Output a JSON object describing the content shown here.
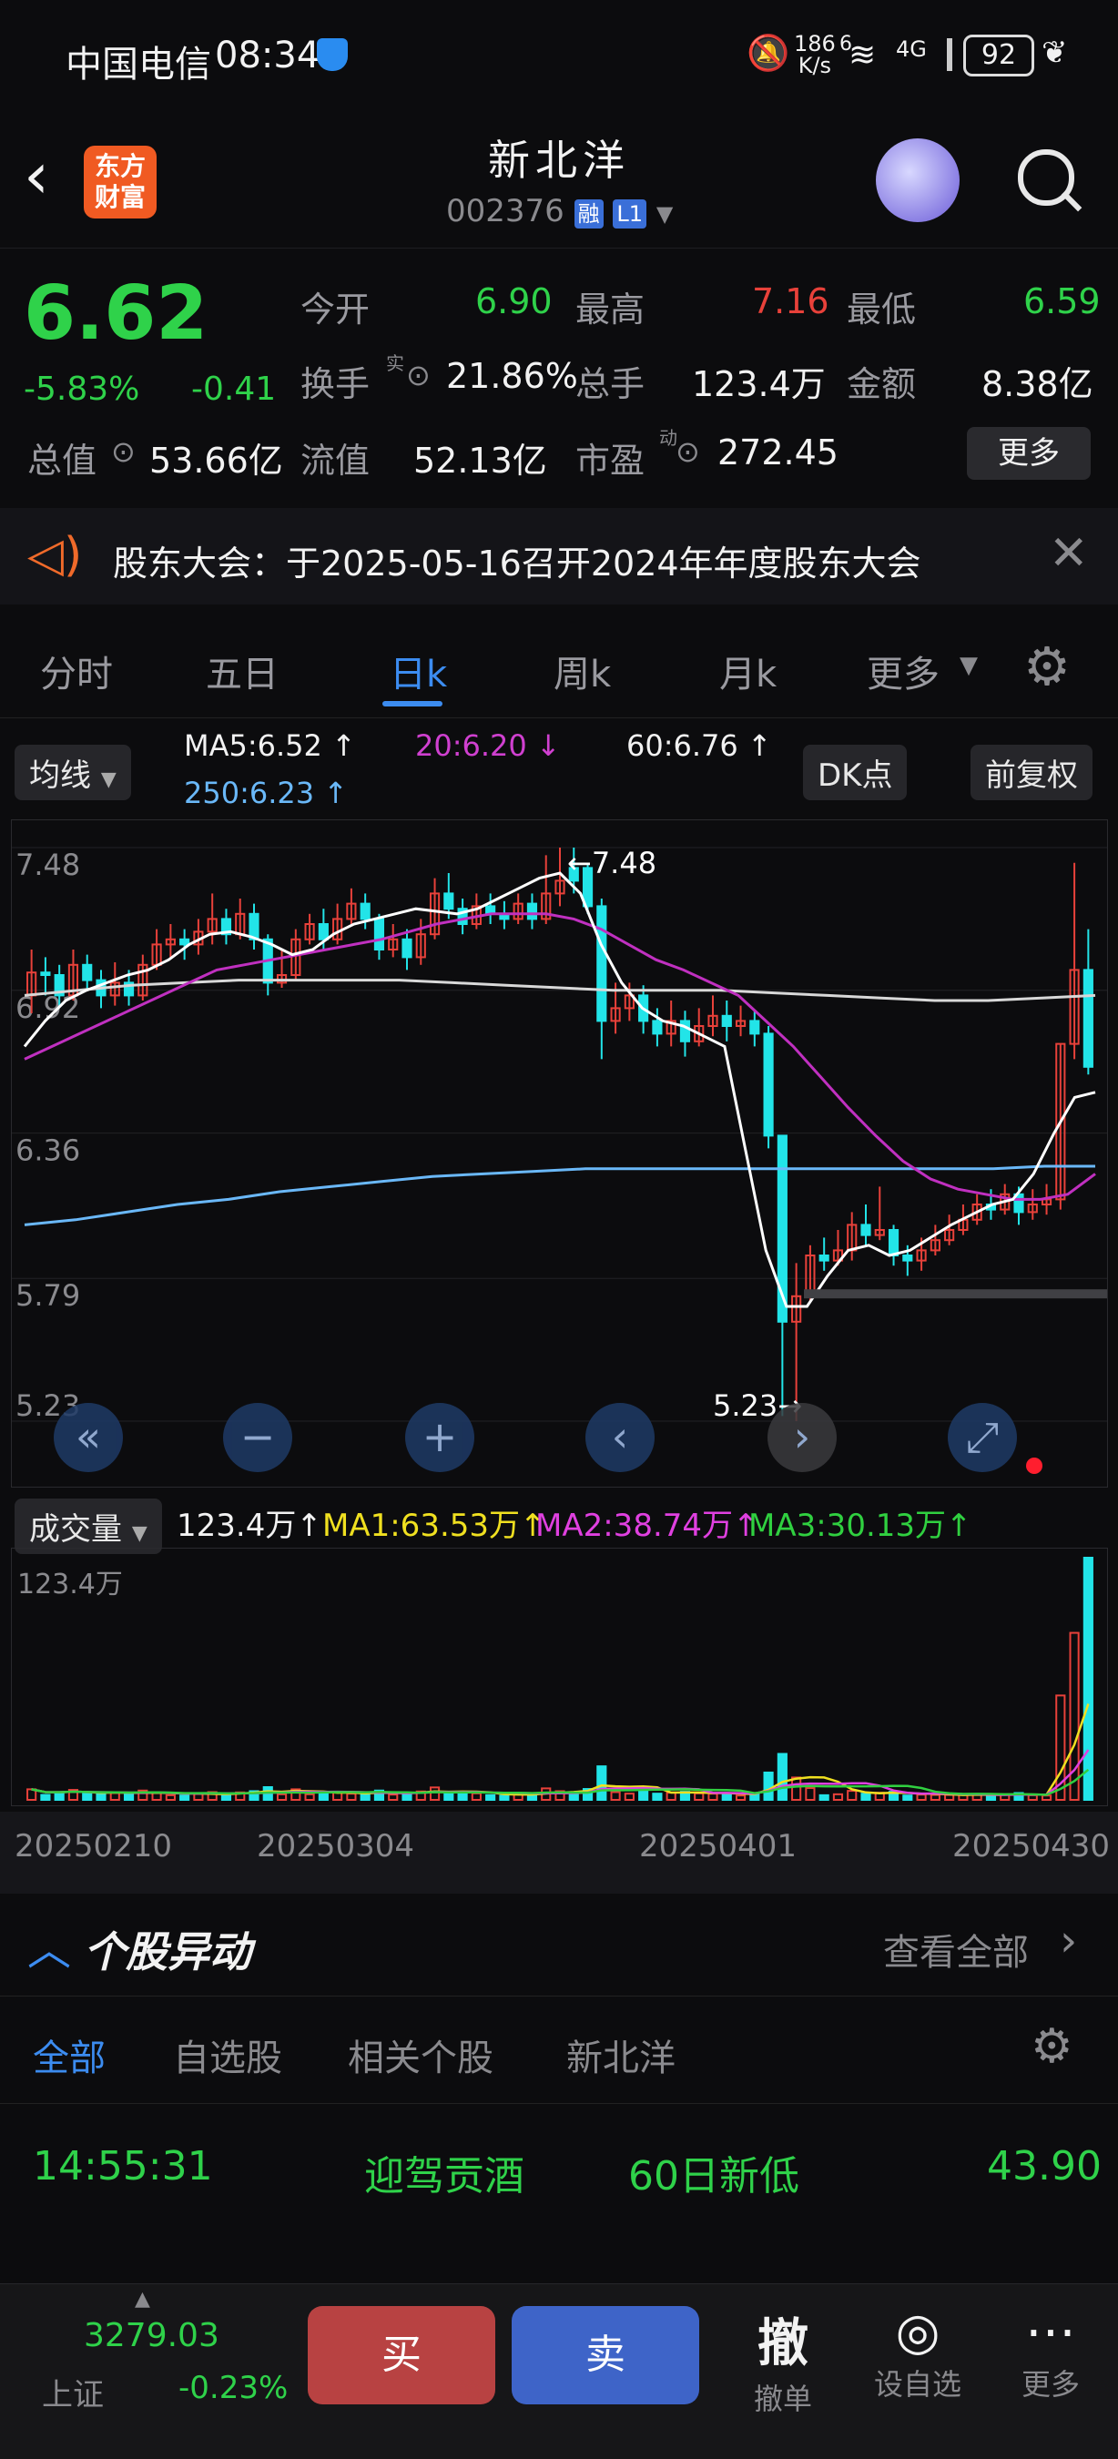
{
  "status_bar": {
    "carrier": "中国电信",
    "time": "08:34",
    "speed_top": "186",
    "speed_unit": "K/s",
    "net_sup": "6",
    "net_type": "4G",
    "battery": "92"
  },
  "header": {
    "logo_line1": "东方",
    "logo_line2": "财富",
    "stock_name": "新北洋",
    "stock_code": "002376",
    "badge_rong": "融",
    "badge_level": "L1"
  },
  "quote": {
    "price": "6.62",
    "change_pct": "-5.83%",
    "change": "-0.41",
    "open_label": "今开",
    "open": "6.90",
    "high_label": "最高",
    "high": "7.16",
    "low_label": "最低",
    "low": "6.59",
    "turnover_label": "换手",
    "turnover_sup": "实",
    "turnover": "21.86%",
    "volume_label": "总手",
    "volume": "123.4万",
    "amount_label": "金额",
    "amount": "8.38亿",
    "mcap_label": "总值",
    "mcap": "53.66亿",
    "float_label": "流值",
    "float": "52.13亿",
    "pe_label": "市盈",
    "pe_sup": "动",
    "pe": "272.45",
    "more": "更多"
  },
  "notice": {
    "text": "股东大会：于2025-05-16召开2024年年度股东大会"
  },
  "tabs": [
    {
      "label": "分时"
    },
    {
      "label": "五日"
    },
    {
      "label": "日k"
    },
    {
      "label": "周k"
    },
    {
      "label": "月k"
    },
    {
      "label": "更多"
    }
  ],
  "ma_bar": {
    "indicator": "均线",
    "ma5": "MA5:6.52 ↑",
    "ma20": "20:6.20 ↓",
    "ma60": "60:6.76 ↑",
    "ma250": "250:6.23 ↑",
    "dk": "DK点",
    "fq": "前复权"
  },
  "vol_bar": {
    "indicator": "成交量",
    "vol": "123.4万↑",
    "ma1": "MA1:63.53万↑",
    "ma2": "MA2:38.74万↑",
    "ma3": "MA3:30.13万↑",
    "vol_max": "123.4万"
  },
  "chart_data": {
    "type": "candlestick",
    "y_ticks": [
      "7.48",
      "6.92",
      "6.36",
      "5.79",
      "5.23"
    ],
    "ylim": [
      5.23,
      7.48
    ],
    "x_labels": [
      "20250210",
      "20250304",
      "20250401",
      "20250430"
    ],
    "high_annot": "←7.48",
    "low_annot": "5.23→",
    "candles": [
      [
        6.9,
        6.99,
        7.08,
        6.83,
        "up"
      ],
      [
        6.99,
        6.98,
        7.05,
        6.9,
        "down"
      ],
      [
        6.98,
        6.9,
        7.02,
        6.86,
        "down"
      ],
      [
        6.9,
        7.02,
        7.08,
        6.88,
        "up"
      ],
      [
        7.02,
        6.96,
        7.06,
        6.92,
        "down"
      ],
      [
        6.96,
        6.9,
        7.0,
        6.85,
        "down"
      ],
      [
        6.9,
        6.95,
        7.03,
        6.86,
        "up"
      ],
      [
        6.95,
        6.9,
        7.0,
        6.86,
        "down"
      ],
      [
        6.9,
        7.02,
        7.06,
        6.88,
        "up"
      ],
      [
        7.02,
        7.1,
        7.16,
        7.0,
        "up"
      ],
      [
        7.1,
        7.12,
        7.18,
        7.05,
        "up"
      ],
      [
        7.12,
        7.1,
        7.16,
        7.04,
        "down"
      ],
      [
        7.1,
        7.15,
        7.2,
        7.06,
        "up"
      ],
      [
        7.15,
        7.2,
        7.3,
        7.1,
        "up"
      ],
      [
        7.2,
        7.14,
        7.24,
        7.1,
        "down"
      ],
      [
        7.14,
        7.22,
        7.28,
        7.12,
        "up"
      ],
      [
        7.22,
        7.12,
        7.26,
        7.08,
        "down"
      ],
      [
        7.12,
        6.95,
        7.14,
        6.9,
        "down"
      ],
      [
        6.95,
        6.98,
        7.08,
        6.93,
        "up"
      ],
      [
        6.98,
        7.12,
        7.16,
        6.96,
        "up"
      ],
      [
        7.12,
        7.18,
        7.22,
        7.1,
        "up"
      ],
      [
        7.18,
        7.12,
        7.24,
        7.08,
        "down"
      ],
      [
        7.12,
        7.2,
        7.26,
        7.1,
        "up"
      ],
      [
        7.2,
        7.26,
        7.32,
        7.18,
        "up"
      ],
      [
        7.26,
        7.2,
        7.3,
        7.16,
        "down"
      ],
      [
        7.2,
        7.08,
        7.22,
        7.04,
        "down"
      ],
      [
        7.08,
        7.12,
        7.18,
        7.05,
        "up"
      ],
      [
        7.12,
        7.05,
        7.16,
        7.0,
        "down"
      ],
      [
        7.05,
        7.14,
        7.2,
        7.02,
        "up"
      ],
      [
        7.14,
        7.3,
        7.36,
        7.12,
        "up"
      ],
      [
        7.3,
        7.24,
        7.38,
        7.2,
        "down"
      ],
      [
        7.24,
        7.18,
        7.28,
        7.14,
        "down"
      ],
      [
        7.18,
        7.25,
        7.3,
        7.16,
        "up"
      ],
      [
        7.25,
        7.22,
        7.3,
        7.18,
        "down"
      ],
      [
        7.22,
        7.2,
        7.27,
        7.16,
        "down"
      ],
      [
        7.2,
        7.26,
        7.3,
        7.18,
        "up"
      ],
      [
        7.26,
        7.2,
        7.3,
        7.16,
        "down"
      ],
      [
        7.2,
        7.3,
        7.45,
        7.18,
        "up"
      ],
      [
        7.3,
        7.35,
        7.48,
        7.25,
        "up"
      ],
      [
        7.35,
        7.4,
        7.48,
        7.3,
        "down"
      ],
      [
        7.4,
        7.25,
        7.42,
        7.22,
        "down"
      ],
      [
        7.25,
        6.8,
        7.28,
        6.65,
        "down"
      ],
      [
        6.8,
        6.85,
        6.95,
        6.75,
        "up"
      ],
      [
        6.85,
        6.9,
        6.95,
        6.8,
        "up"
      ],
      [
        6.9,
        6.8,
        6.94,
        6.75,
        "down"
      ],
      [
        6.8,
        6.75,
        6.85,
        6.7,
        "down"
      ],
      [
        6.75,
        6.8,
        6.88,
        6.7,
        "up"
      ],
      [
        6.8,
        6.72,
        6.84,
        6.66,
        "down"
      ],
      [
        6.72,
        6.78,
        6.85,
        6.7,
        "up"
      ],
      [
        6.78,
        6.82,
        6.9,
        6.74,
        "up"
      ],
      [
        6.82,
        6.78,
        6.88,
        6.72,
        "down"
      ],
      [
        6.78,
        6.8,
        6.86,
        6.74,
        "up"
      ],
      [
        6.8,
        6.75,
        6.84,
        6.7,
        "down"
      ],
      [
        6.75,
        6.35,
        6.78,
        6.3,
        "down"
      ],
      [
        6.35,
        5.62,
        6.0,
        5.25,
        "down"
      ],
      [
        5.62,
        5.72,
        5.85,
        5.23,
        "up"
      ],
      [
        5.72,
        5.88,
        5.92,
        5.7,
        "up"
      ],
      [
        5.88,
        5.86,
        5.95,
        5.82,
        "down"
      ],
      [
        5.86,
        5.9,
        5.98,
        5.84,
        "up"
      ],
      [
        5.9,
        6.0,
        6.05,
        5.86,
        "up"
      ],
      [
        6.0,
        5.96,
        6.08,
        5.92,
        "down"
      ],
      [
        5.96,
        5.98,
        6.15,
        5.94,
        "up"
      ],
      [
        5.98,
        5.88,
        6.0,
        5.84,
        "down"
      ],
      [
        5.88,
        5.86,
        5.92,
        5.8,
        "down"
      ],
      [
        5.86,
        5.9,
        5.95,
        5.82,
        "up"
      ],
      [
        5.9,
        5.94,
        6.0,
        5.88,
        "up"
      ],
      [
        5.94,
        5.98,
        6.04,
        5.92,
        "up"
      ],
      [
        5.98,
        6.02,
        6.08,
        5.96,
        "up"
      ],
      [
        6.02,
        6.08,
        6.12,
        6.0,
        "up"
      ],
      [
        6.08,
        6.06,
        6.14,
        6.02,
        "down"
      ],
      [
        6.06,
        6.12,
        6.16,
        6.04,
        "up"
      ],
      [
        6.12,
        6.05,
        6.15,
        6.0,
        "down"
      ],
      [
        6.05,
        6.08,
        6.14,
        6.02,
        "up"
      ],
      [
        6.08,
        6.1,
        6.16,
        6.04,
        "up"
      ],
      [
        6.1,
        6.71,
        6.71,
        6.06,
        "up"
      ],
      [
        6.71,
        7.0,
        7.42,
        6.65,
        "up"
      ],
      [
        7.0,
        6.62,
        7.16,
        6.59,
        "down"
      ]
    ],
    "ma5": [
      6.7,
      6.8,
      6.88,
      6.92,
      6.95,
      6.98,
      7.0,
      7.04,
      7.1,
      7.14,
      7.15,
      7.13,
      7.1,
      7.06,
      7.08,
      7.14,
      7.18,
      7.2,
      7.22,
      7.24,
      7.23,
      7.22,
      7.24,
      7.28,
      7.32,
      7.36,
      7.38,
      7.3,
      7.1,
      6.95,
      6.85,
      6.8,
      6.78,
      6.74,
      6.7,
      6.3,
      5.9,
      5.68,
      5.68,
      5.8,
      5.9,
      5.92,
      5.88,
      5.9,
      5.95,
      6.0,
      6.04,
      6.08,
      6.1,
      6.2,
      6.36,
      6.5,
      6.52
    ],
    "ma20": [
      6.65,
      6.7,
      6.75,
      6.8,
      6.85,
      6.9,
      6.95,
      7.0,
      7.02,
      7.04,
      7.06,
      7.08,
      7.1,
      7.12,
      7.15,
      7.18,
      7.2,
      7.22,
      7.22,
      7.22,
      7.2,
      7.16,
      7.1,
      7.04,
      7.0,
      6.95,
      6.9,
      6.8,
      6.7,
      6.58,
      6.46,
      6.35,
      6.25,
      6.18,
      6.14,
      6.12,
      6.1,
      6.1,
      6.12,
      6.2
    ],
    "ma60": [
      6.9,
      6.92,
      6.94,
      6.95,
      6.96,
      6.96,
      6.96,
      6.96,
      6.95,
      6.94,
      6.93,
      6.92,
      6.92,
      6.92,
      6.91,
      6.9,
      6.89,
      6.88,
      6.88,
      6.89,
      6.9
    ],
    "ma250": [
      6.0,
      6.02,
      6.05,
      6.08,
      6.1,
      6.13,
      6.15,
      6.17,
      6.19,
      6.2,
      6.21,
      6.22,
      6.22,
      6.22,
      6.22,
      6.22,
      6.22,
      6.22,
      6.22,
      6.22,
      6.23,
      6.23
    ]
  },
  "move": {
    "title": "个股异动",
    "view_all": "查看全部",
    "tabs": [
      {
        "label": "全部"
      },
      {
        "label": "自选股"
      },
      {
        "label": "相关个股"
      },
      {
        "label": "新北洋"
      }
    ],
    "row": {
      "time": "14:55:31",
      "name": "迎驾贡酒",
      "event": "60日新低",
      "value": "43.90"
    }
  },
  "bottom": {
    "index_val": "3279.03",
    "index_name": "上证",
    "index_chg": "-0.23%",
    "buy": "买",
    "sell": "卖",
    "cancel_icon": "撤",
    "cancel": "撤单",
    "watch": "设自选",
    "more": "更多"
  }
}
